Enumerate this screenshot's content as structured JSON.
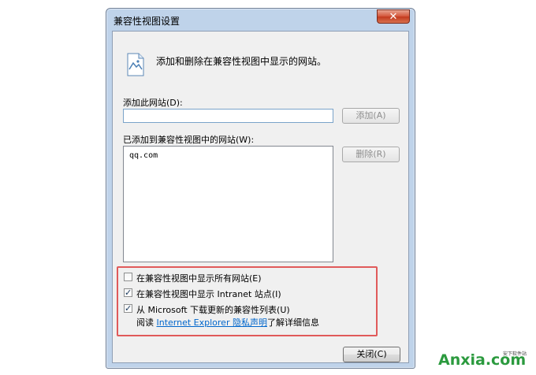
{
  "dialog": {
    "title": "兼容性视图设置",
    "close_glyph": "✕",
    "header_text": "添加和删除在兼容性视图中显示的网站。",
    "add_label": "添加此网站(D):",
    "add_input_value": "",
    "add_button": "添加(A)",
    "added_label": "已添加到兼容性视图中的网站(W):",
    "sites": [
      "qq.com"
    ],
    "remove_button": "删除(R)",
    "options": [
      {
        "label": "在兼容性视图中显示所有网站(E)",
        "checked": false
      },
      {
        "label": "在兼容性视图中显示 Intranet 站点(I)",
        "checked": true
      },
      {
        "label": "从 Microsoft 下载更新的兼容性列表(U)",
        "checked": true
      }
    ],
    "read_prefix": "阅读",
    "privacy_link": "Internet Explorer 隐私声明",
    "read_suffix": "了解详细信息",
    "close_button": "关闭(C)"
  },
  "watermark": {
    "brand": "Anxia.com",
    "sub": "安下软件站"
  },
  "colors": {
    "frame": "#bfd3ea",
    "highlight": "#e05a5a",
    "link": "#0066cc"
  }
}
